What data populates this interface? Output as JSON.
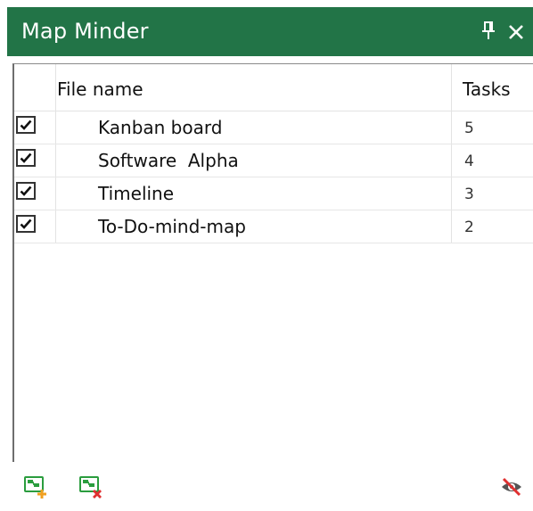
{
  "window": {
    "title": "Map Minder",
    "pin_icon": "pin-icon",
    "close_icon": "close-icon"
  },
  "table": {
    "columns": {
      "name": "File name",
      "tasks": "Tasks"
    },
    "rows": [
      {
        "checked": true,
        "name": "Kanban board",
        "tasks": "5"
      },
      {
        "checked": true,
        "name": "Software  Alpha",
        "tasks": "4"
      },
      {
        "checked": true,
        "name": "Timeline",
        "tasks": "3"
      },
      {
        "checked": true,
        "name": "To-Do-mind-map",
        "tasks": "2"
      }
    ]
  },
  "toolbar": {
    "add_icon": "add-map-icon",
    "remove_icon": "remove-map-icon",
    "hide_icon": "hide-eye-icon"
  },
  "colors": {
    "title_bar": "#227447",
    "icon_green": "#2a9d3e",
    "icon_add": "#f0a020",
    "icon_remove": "#e03030"
  }
}
